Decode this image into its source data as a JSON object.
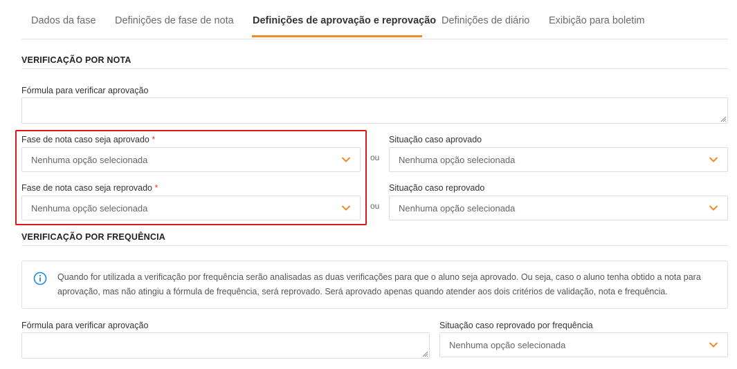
{
  "tabs": [
    {
      "label": "Dados da fase"
    },
    {
      "label": "Definições de fase de nota"
    },
    {
      "label": "Definições de aprovação e reprovação"
    },
    {
      "label": "Definições de diário"
    },
    {
      "label": "Exibição para boletim"
    }
  ],
  "active_tab": "Definições de aprovação e reprovação",
  "colors": {
    "accent": "#f08a24",
    "highlight": "#d7191c",
    "required": "#e53935"
  },
  "nota": {
    "title": "VERIFICAÇÃO POR NOTA",
    "formula_label": "Fórmula para verificar aprovação",
    "formula_value": "",
    "fase_aprovado": {
      "label": "Fase de nota caso seja aprovado",
      "required_mark": "*",
      "value": "Nenhuma opção selecionada"
    },
    "fase_reprovado": {
      "label": "Fase de nota caso seja reprovado",
      "required_mark": "*",
      "value": "Nenhuma opção selecionada"
    },
    "ou_1": "ou",
    "ou_2": "ou",
    "situacao_aprovado": {
      "label": "Situação caso aprovado",
      "value": "Nenhuma opção selecionada"
    },
    "situacao_reprovado": {
      "label": "Situação caso reprovado",
      "value": "Nenhuma opção selecionada"
    }
  },
  "frequencia": {
    "title": "VERIFICAÇÃO POR FREQUÊNCIA",
    "info_icon": "info-icon",
    "info_text": "Quando for utilizada a verificação por frequência serão analisadas as duas verificações para que o aluno seja aprovado. Ou seja, caso o aluno tenha obtido a nota para aprovação, mas não atingiu a fórmula de frequência, será reprovado. Será aprovado apenas quando atender aos dois critérios de validação, nota e frequência.",
    "formula_label": "Fórmula para verificar aprovação",
    "formula_value": "",
    "situacao_reprovado_freq": {
      "label": "Situação caso reprovado por frequência",
      "value": "Nenhuma opção selecionada"
    }
  }
}
